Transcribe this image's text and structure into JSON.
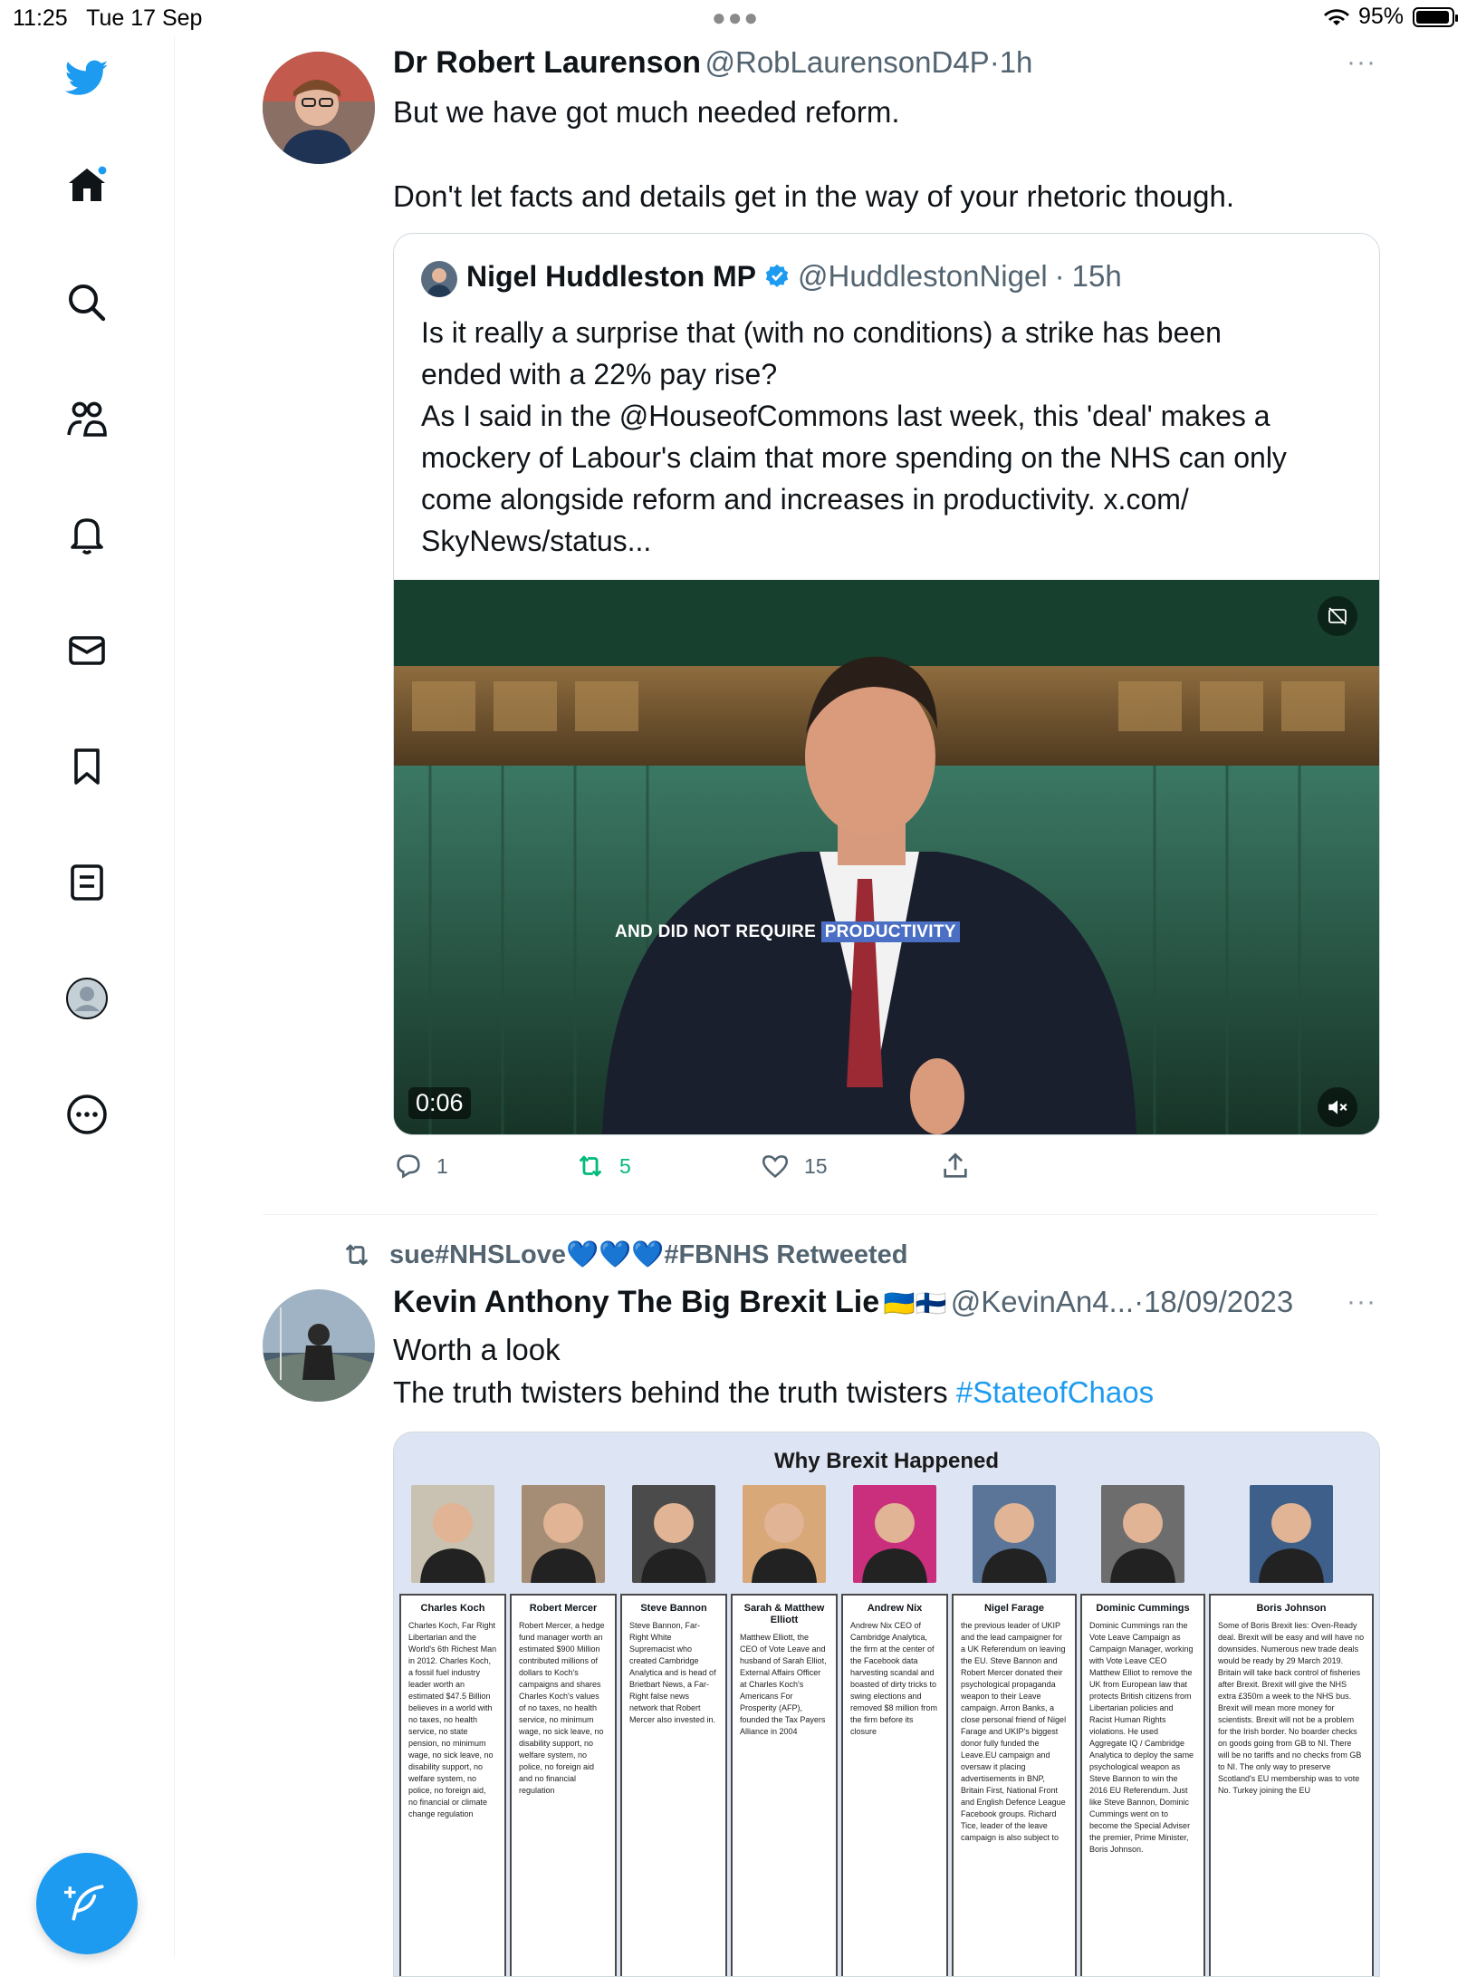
{
  "status_bar": {
    "time": "11:25",
    "date": "Tue 17 Sep",
    "battery": "95%",
    "battery_level": 0.95
  },
  "sidebar": {
    "items": [
      {
        "icon": "twitter-bird-icon"
      },
      {
        "icon": "home-icon"
      },
      {
        "icon": "search-icon"
      },
      {
        "icon": "communities-icon"
      },
      {
        "icon": "notifications-bell-icon"
      },
      {
        "icon": "messages-envelope-icon"
      },
      {
        "icon": "bookmark-icon"
      },
      {
        "icon": "lists-icon"
      },
      {
        "icon": "profile-avatar-icon"
      },
      {
        "icon": "more-circle-icon"
      }
    ],
    "compose_icon": "compose-feather-icon"
  },
  "tweet1": {
    "name": "Dr Robert Laurenson",
    "handle": "@RobLaurensonD4P",
    "sep": "·",
    "time": "1h",
    "line1": "But we have got much needed reform.",
    "line2": "Don't let facts and details get in the way of your rhetoric though.",
    "more": "···",
    "quote": {
      "name": "Nigel Huddleston MP",
      "handle": "@HuddlestonNigel",
      "sep": "·",
      "time": "15h",
      "lines": [
        "Is it really a surprise that (with no conditions) a strike has been",
        "ended with a 22% pay rise?",
        "As I said in the @HouseofCommons last week, this 'deal' makes a",
        "mockery of Labour's claim that more spending on the NHS can only",
        "come alongside reform and increases in productivity. x.com/",
        "SkyNews/status..."
      ],
      "video": {
        "caption_a": "AND DID NOT REQUIRE ",
        "caption_b": "PRODUCTIVITY",
        "duration": "0:06"
      }
    },
    "actions": {
      "replies": "1",
      "retweets": "5",
      "likes": "15"
    }
  },
  "tweet2": {
    "retweeted_by": "sue#NHSLove💙💙💙#FBNHS Retweeted",
    "name": "Kevin Anthony The Big Brexit Lie",
    "flags": "🇺🇦🇫🇮",
    "handle": "@KevinAn4...",
    "sep": "·",
    "time": "18/09/2023",
    "more": "···",
    "line1": "Worth a look",
    "line2": "The truth twisters behind the truth twisters ",
    "hashtag": "#StateofChaos",
    "infographic": {
      "title": "Why Brexit Happened",
      "columns": [
        {
          "name": "Charles Koch",
          "text": "Charles Koch, Far Right Libertarian and the World's 6th Richest Man in 2012. Charles Koch, a fossil fuel industry leader worth an estimated $47.5 Billion believes in a world with no taxes, no health service, no state pension, no minimum wage, no sick leave, no disability support, no welfare system, no police, no foreign aid, no financial or climate change regulation"
        },
        {
          "name": "Robert Mercer",
          "text": "Robert Mercer, a hedge fund manager worth an estimated $900 Million contributed millions of dollars to Koch's campaigns and shares Charles Koch's values of no taxes, no health service, no minimum wage, no sick leave, no disability support, no welfare system, no police, no foreign aid and no financial regulation"
        },
        {
          "name": "Steve Bannon",
          "text": "Steve Bannon, Far-Right White Supremacist who created Cambridge Analytica and is head of Brietbart News, a Far-Right false news network that Robert Mercer also invested in."
        },
        {
          "name": "Sarah & Matthew Elliott",
          "text": "Matthew Elliott, the CEO of Vote Leave and husband of Sarah Elliot, External Affairs Officer at Charles Koch's Americans For Prosperity (AFP), founded the Tax Payers Alliance in 2004"
        },
        {
          "name": "Andrew Nix",
          "text": "Andrew Nix CEO of Cambridge Analytica, the firm at the center of the Facebook data harvesting scandal and boasted of dirty tricks to swing elections and removed $8 million from the firm before its closure"
        },
        {
          "name": "Nigel Farage",
          "text": "the previous leader of UKIP and the lead campaigner for a UK Referendum on leaving the EU. Steve Bannon and Robert Mercer donated their psychological propaganda weapon to their Leave campaign. Arron Banks, a close personal friend of Nigel Farage and UKIP's biggest donor fully funded the Leave.EU campaign and oversaw it placing advertisements in BNP, Britain First, National Front and English Defence League Facebook groups. Richard Tice, leader of the leave campaign is also subject to"
        },
        {
          "name": "Dominic Cummings",
          "text": "Dominic Cummings ran the Vote Leave Campaign as Campaign Manager, working with Vote Leave CEO Matthew Elliot to remove the UK from European law that protects British citizens from Libertarian policies and Racist Human Rights violations. He used Aggregate IQ / Cambridge Analytica to deploy the same psychological weapon as Steve Bannon to win the 2016 EU Referendum. Just like Steve Bannon, Dominic Cummings went on to become the Special Adviser the premier, Prime Minister, Boris Johnson."
        },
        {
          "name": "Boris Johnson",
          "text": "Some of Boris Brexit lies: Oven-Ready deal. Brexit will be easy and will have no downsides. Numerous new trade deals would be ready by 29 March 2019. Britain will take back control of fisheries after Brexit. Brexit will give the NHS extra £350m a week to the NHS bus. Brexit will mean more money for scientists. Brexit will not be a problem for the Irish border. No boarder checks on goods going from GB to NI. There will be no tariffs and no checks from GB to NI. The only way to preserve Scotland's EU membership was to vote No. Turkey joining the EU"
        }
      ]
    }
  },
  "colors": {
    "accent": "#1d9bf0",
    "retweet_green": "#00ba7c",
    "muted": "#536471",
    "border": "#cfd9de"
  }
}
